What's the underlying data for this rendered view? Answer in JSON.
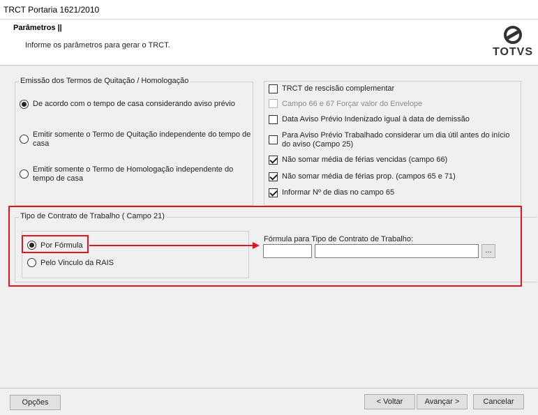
{
  "window": {
    "title": "TRCT Portaria 1621/2010"
  },
  "header": {
    "title": "Parâmetros ||",
    "subtitle": "Informe os parâmetros para gerar o TRCT.",
    "logo_text": "TOTVS"
  },
  "emissao": {
    "legend": "Emissão dos Termos de Quitação / Homologação",
    "options": [
      {
        "label": "De acordo com o tempo de casa considerando aviso prévio",
        "selected": true
      },
      {
        "label_line1": "Emitir somente o Termo de Quitação independente do tempo de",
        "label_line2": "casa",
        "selected": false
      },
      {
        "label_line1": "Emitir somente o Termo de Homologação independente do",
        "label_line2": "tempo de casa",
        "selected": false
      }
    ]
  },
  "checks": [
    {
      "label": "TRCT de rescisão complementar",
      "checked": false,
      "disabled": false
    },
    {
      "label": "Campo 66 e 67 Forçar valor do Envelope",
      "checked": false,
      "disabled": true
    },
    {
      "label": "Data Aviso Prévio Indenizado igual à data de demissão",
      "checked": false,
      "disabled": false
    },
    {
      "label_line1": "Para Aviso Prévio Trabalhado considerar um dia útil antes do início",
      "label_line2": "do aviso (Campo 25)",
      "checked": false,
      "disabled": false
    },
    {
      "label": "Não somar média de férias vencidas (campo 66)",
      "checked": true,
      "disabled": false
    },
    {
      "label": "Não somar média de férias prop. (campos 65 e 71)",
      "checked": true,
      "disabled": false
    },
    {
      "label": "Informar Nº de dias no campo 65",
      "checked": true,
      "disabled": false
    }
  ],
  "contrato": {
    "legend": "Tipo de Contrato de Trabalho ( Campo 21)",
    "options": [
      {
        "label": "Por Fórmula",
        "selected": true
      },
      {
        "label": "Pelo Vinculo da RAIS",
        "selected": false
      }
    ],
    "formula_label": "Fórmula para Tipo de Contrato de Trabalho:",
    "formula_code": "",
    "formula_desc": "",
    "lookup_label": "..."
  },
  "footer": {
    "options_label": "Opções",
    "back_label": "< Voltar",
    "next_label": "Avançar >",
    "cancel_label": "Cancelar"
  },
  "colors": {
    "highlight": "#e3141d",
    "background": "#f0f0f0"
  }
}
